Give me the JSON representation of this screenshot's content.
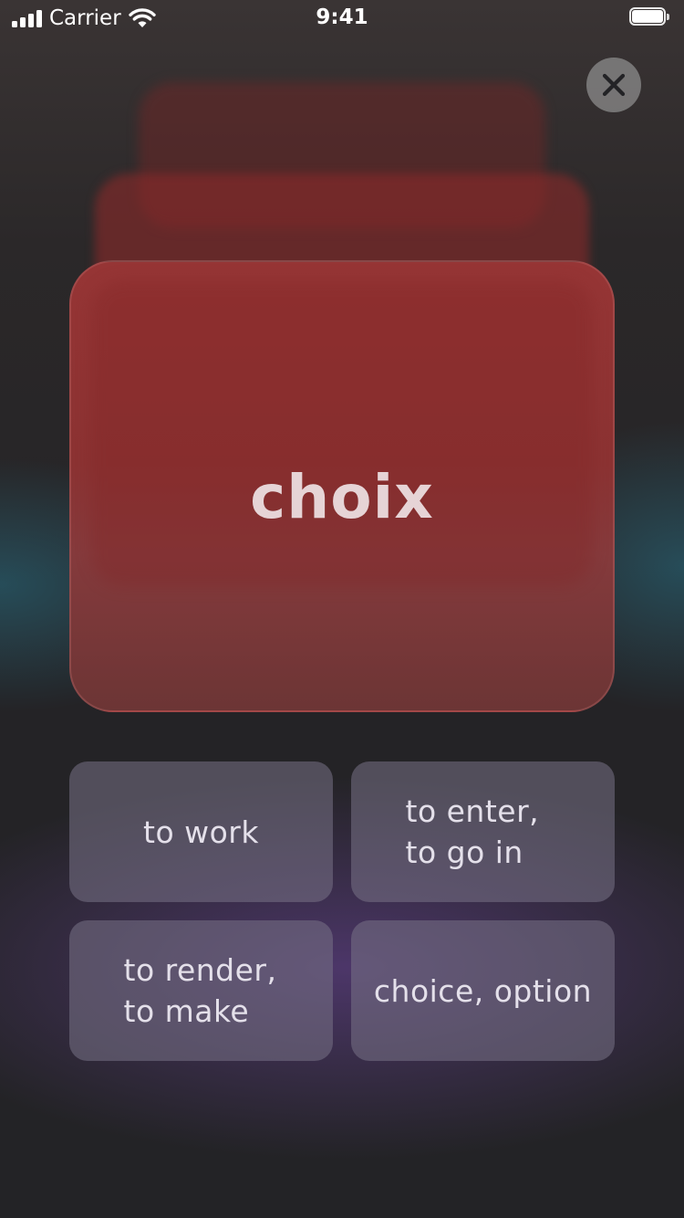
{
  "status_bar": {
    "carrier": "Carrier",
    "time": "9:41",
    "icons": [
      "signal-icon",
      "wifi-icon",
      "battery-icon"
    ]
  },
  "close_button": {
    "icon": "close-icon"
  },
  "flashcard": {
    "word": "choix",
    "color": "#8b3232"
  },
  "options": [
    {
      "label": "to work"
    },
    {
      "label": "to enter, to go in"
    },
    {
      "label": "to render, to make"
    },
    {
      "label": "choice, option"
    }
  ],
  "colors": {
    "background": "#232326",
    "card": "#8b3232",
    "option_tile": "#6e6a7a",
    "accent_teal": "#286e82",
    "accent_purple": "#6e46a0"
  }
}
